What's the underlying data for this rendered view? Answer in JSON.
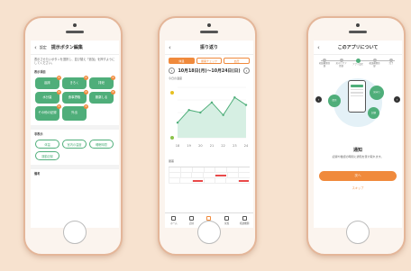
{
  "phone1": {
    "header_title": "提示ボタン編集",
    "back_label": "設定",
    "description": "表示させたいボタンを選択し、並び替え「追加」を押すようにしてください。",
    "section_a": "表示項目",
    "green_buttons": [
      "起床",
      "きろく",
      "排泄",
      "水分量",
      "食事摂取",
      "服薬しる",
      "その他の記録",
      "外出"
    ],
    "section_b": "非表示",
    "pill_buttons": [
      "体温",
      "室内の温度",
      "睡眠時間",
      "運動記録"
    ],
    "section_c": "備考"
  },
  "phone2": {
    "header_title": "振り返り",
    "tabs": [
      "体温",
      "服薬チェック",
      "血圧"
    ],
    "date_range": "10月18日(月)〜10月24日(日)",
    "chart_label": "今日の温度",
    "table_label": "服薬",
    "nav": [
      "ホーム",
      "記録",
      "振り返り",
      "家族",
      "相談機関"
    ],
    "chart_data": {
      "type": "line",
      "categories": [
        "18",
        "19",
        "20",
        "21",
        "22",
        "23",
        "24"
      ],
      "values": [
        36.1,
        36.6,
        36.5,
        36.9,
        36.4,
        37.1,
        36.8
      ],
      "ylim": [
        35.5,
        37.5
      ]
    }
  },
  "phone3": {
    "header_title": "このアプリについて",
    "steps": [
      "相談機関登録",
      "見守りケア登録",
      "アプリ設定",
      "相談機関登録",
      "完了"
    ],
    "bubble_labels": [
      "提示",
      "見守り",
      "記録"
    ],
    "notice_title": "通知",
    "notice_desc": "記録や確認の時間に通知を受け取れます。",
    "next_label": "次へ",
    "skip_label": "スキップ"
  }
}
